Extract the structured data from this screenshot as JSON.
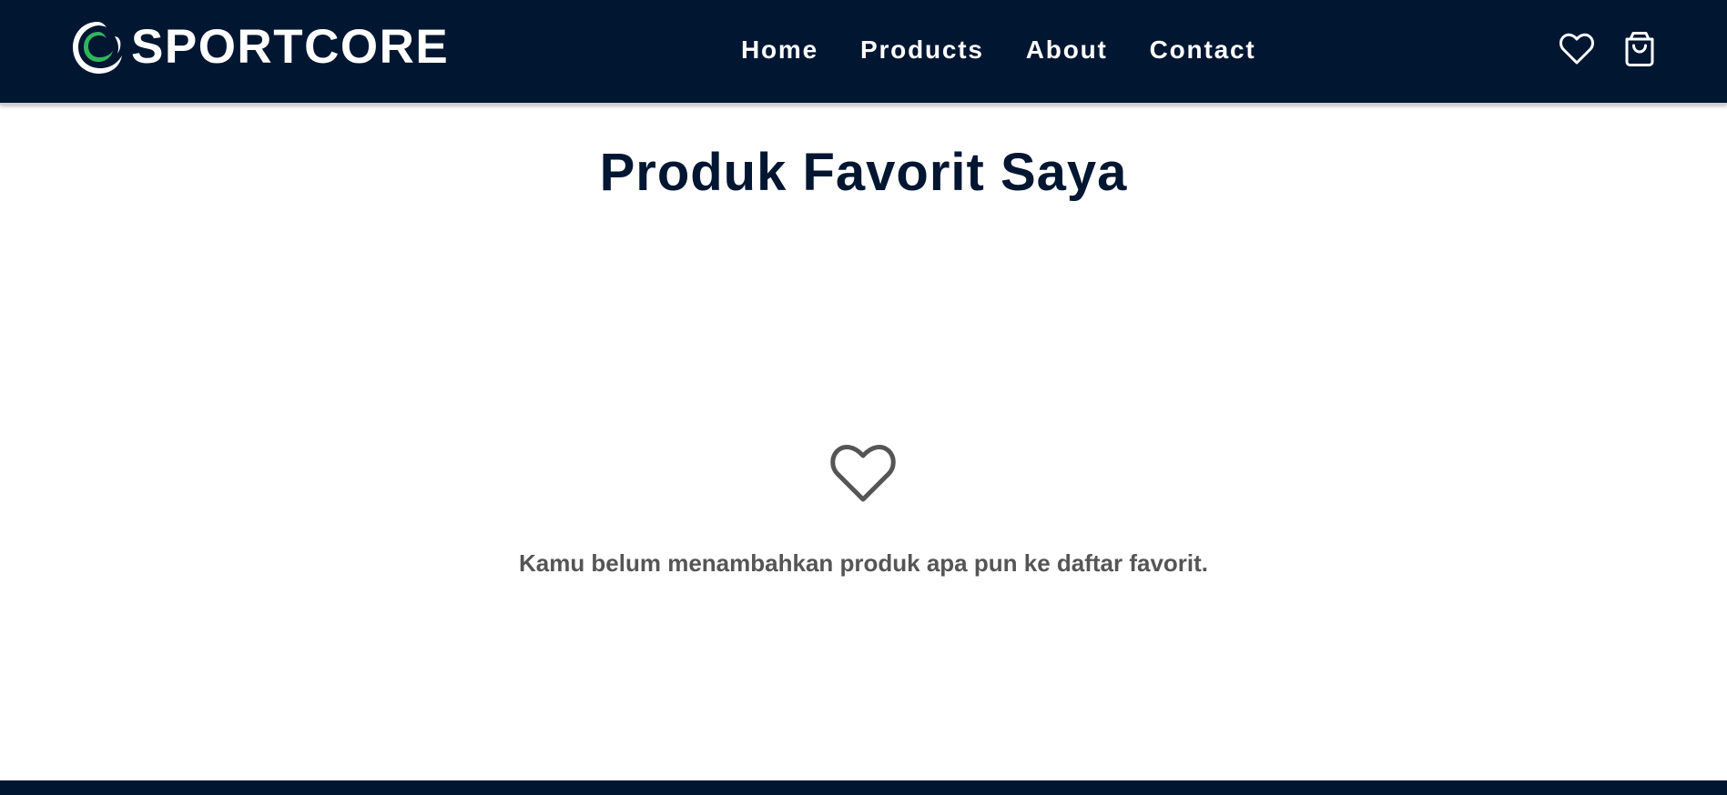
{
  "brand": {
    "name": "SPORTCORE",
    "logo_icon": "swirl-logo-icon",
    "accent": "#2fb65d"
  },
  "nav": {
    "links": [
      {
        "label": "Home"
      },
      {
        "label": "Products"
      },
      {
        "label": "About"
      },
      {
        "label": "Contact"
      }
    ],
    "icons": {
      "favorites": "heart-icon",
      "cart": "shopping-bag-icon"
    }
  },
  "page": {
    "title": "Produk Favorit Saya",
    "empty_icon": "heart-outline-icon",
    "empty_message": "Kamu belum menambahkan produk apa pun ke daftar favorit."
  },
  "colors": {
    "navbar": "#001631",
    "title": "#001631",
    "message": "#555555",
    "icon_gray": "#555555"
  }
}
